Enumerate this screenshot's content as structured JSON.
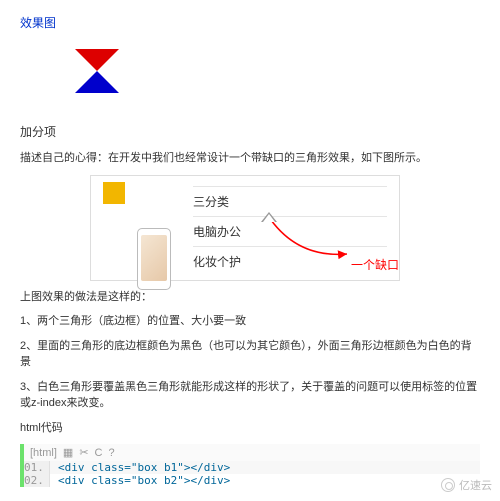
{
  "heading_link": "效果图",
  "section_bonus": "加分项",
  "intro": "描述自己的心得：在开发中我们也经常设计一个带缺口的三角形效果，如下图所示。",
  "diagram": {
    "row1": "三分类",
    "row2": "电脑办公",
    "row3": "化妆个护",
    "callout": "一个缺口"
  },
  "explain_title": "上图效果的做法是这样的：",
  "step1": "1、两个三角形（底边框）的位置、大小要一致",
  "step2": "2、里面的三角形的底边框颜色为黑色（也可以为其它颜色），外面三角形边框颜色为白色的背景",
  "step3": "3、白色三角形要覆盖黑色三角形就能形成这样的形状了，关于覆盖的问题可以使用标签的位置或z-index来改变。",
  "code_label": "html代码",
  "code": {
    "toolbar_label": "[html]",
    "lines": [
      {
        "num": "01.",
        "text": "<div class=\"box b1\"></div>"
      },
      {
        "num": "02.",
        "text": "<div class=\"box b2\"></div>"
      }
    ]
  },
  "watermark": "亿速云"
}
